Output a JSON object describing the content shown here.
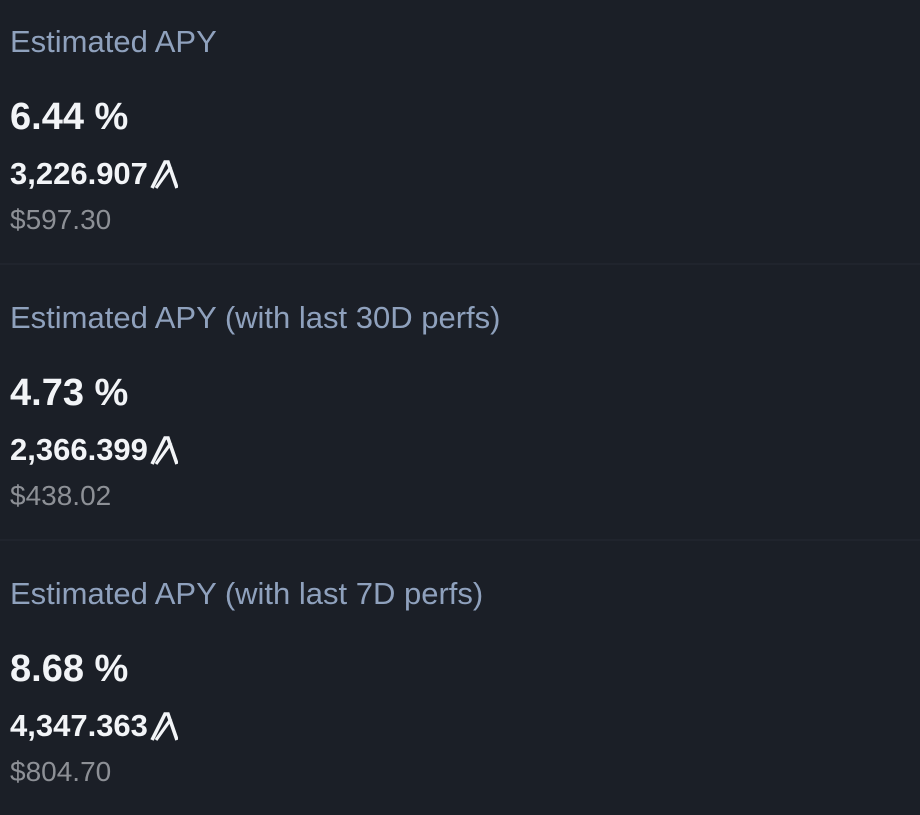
{
  "apy_blocks": [
    {
      "title": "Estimated APY",
      "percent": "6.44 %",
      "amount": "3,226.907",
      "usd": "$597.30"
    },
    {
      "title": "Estimated APY (with last 30D perfs)",
      "percent": "4.73 %",
      "amount": "2,366.399",
      "usd": "$438.02"
    },
    {
      "title": "Estimated APY (with last 7D perfs)",
      "percent": "8.68 %",
      "amount": "4,347.363",
      "usd": "$804.70"
    }
  ],
  "icons": {
    "currency": "algorand-icon"
  },
  "colors": {
    "background": "#1b1f27",
    "title": "#8fa1bd",
    "value": "#f2f4f7",
    "usd": "#8d9096"
  }
}
